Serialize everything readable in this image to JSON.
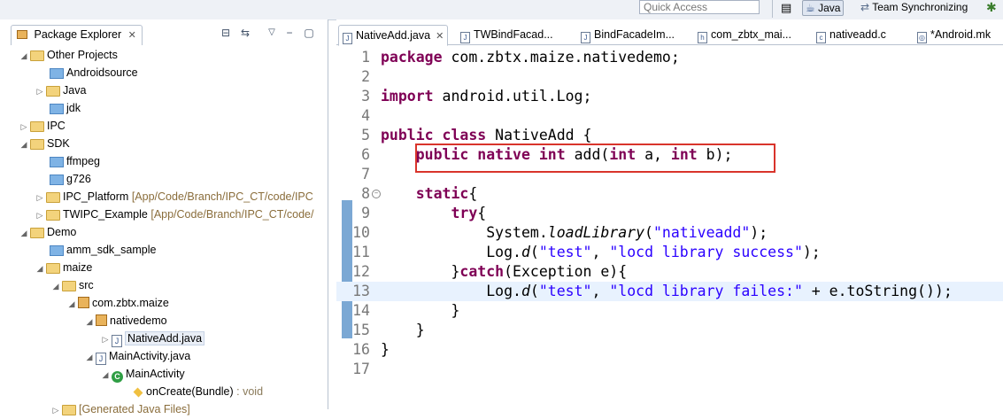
{
  "toolbar": {
    "quick_access_placeholder": "Quick Access",
    "perspective_java": "Java",
    "perspective_team": "Team Synchronizing"
  },
  "package_explorer": {
    "tab_label": "Package Explorer",
    "tree": [
      {
        "label": "Other Projects",
        "extra": ""
      },
      {
        "label": "Androidsource",
        "extra": ""
      },
      {
        "label": "Java",
        "extra": ""
      },
      {
        "label": "jdk",
        "extra": ""
      },
      {
        "label": "IPC",
        "extra": ""
      },
      {
        "label": "SDK",
        "extra": ""
      },
      {
        "label": "ffmpeg",
        "extra": ""
      },
      {
        "label": "g726",
        "extra": ""
      },
      {
        "label": "IPC_Platform",
        "extra": "[App/Code/Branch/IPC_CT/code/IPC"
      },
      {
        "label": "TWIPC_Example",
        "extra": "[App/Code/Branch/IPC_CT/code/"
      },
      {
        "label": "Demo",
        "extra": ""
      },
      {
        "label": "amm_sdk_sample",
        "extra": ""
      },
      {
        "label": "maize",
        "extra": ""
      },
      {
        "label": "src",
        "extra": ""
      },
      {
        "label": "com.zbtx.maize",
        "extra": ""
      },
      {
        "label": "nativedemo",
        "extra": ""
      },
      {
        "label": "NativeAdd.java",
        "extra": ""
      },
      {
        "label": "MainActivity.java",
        "extra": ""
      },
      {
        "label": "MainActivity",
        "extra": ""
      },
      {
        "label": "onCreate(Bundle)",
        "extra": ": void"
      },
      {
        "label": "",
        "extra": "[Generated Java Files]"
      }
    ]
  },
  "editor": {
    "tabs": [
      {
        "label": "NativeAdd.java"
      },
      {
        "label": "TWBindFacad..."
      },
      {
        "label": "BindFacadeIm..."
      },
      {
        "label": "com_zbtx_mai..."
      },
      {
        "label": "nativeadd.c"
      },
      {
        "label": "*Android.mk"
      }
    ],
    "line_numbers": [
      "1",
      "2",
      "3",
      "4",
      "5",
      "6",
      "7",
      "8",
      "9",
      "10",
      "11",
      "12",
      "13",
      "14",
      "15",
      "16",
      "17"
    ],
    "code": {
      "l1_kw": "package",
      "l1_rest": " com.zbtx.maize.nativedemo;",
      "l3_kw": "import",
      "l3_rest": " android.util.Log;",
      "l5_kw1": "public",
      "l5_kw2": "class",
      "l5_rest": " NativeAdd {",
      "l6_kw1": "public",
      "l6_kw2": "native",
      "l6_kw3": "int",
      "l6_a": " add(",
      "l6_kw4": "int",
      "l6_b": " a, ",
      "l6_kw5": "int",
      "l6_c": " b);",
      "l8_kw": "static",
      "l8_rest": "{",
      "l9_kw": "try",
      "l9_rest": "{",
      "l10_a": "System.",
      "l10_m": "loadLibrary",
      "l10_b": "(",
      "l10_s": "\"nativeadd\"",
      "l10_c": ");",
      "l11_a": "Log.",
      "l11_m": "d",
      "l11_b": "(",
      "l11_s1": "\"test\"",
      "l11_c": ", ",
      "l11_s2": "\"locd library success\"",
      "l11_d": ");",
      "l12_a": "}",
      "l12_kw": "catch",
      "l12_rest": "(Exception e){",
      "l13_a": "Log.",
      "l13_m": "d",
      "l13_b": "(",
      "l13_s1": "\"test\"",
      "l13_c": ", ",
      "l13_s2": "\"locd library failes:\"",
      "l13_d": " + e.toString());",
      "l14": "}",
      "l15": "}",
      "l16": "}"
    }
  }
}
